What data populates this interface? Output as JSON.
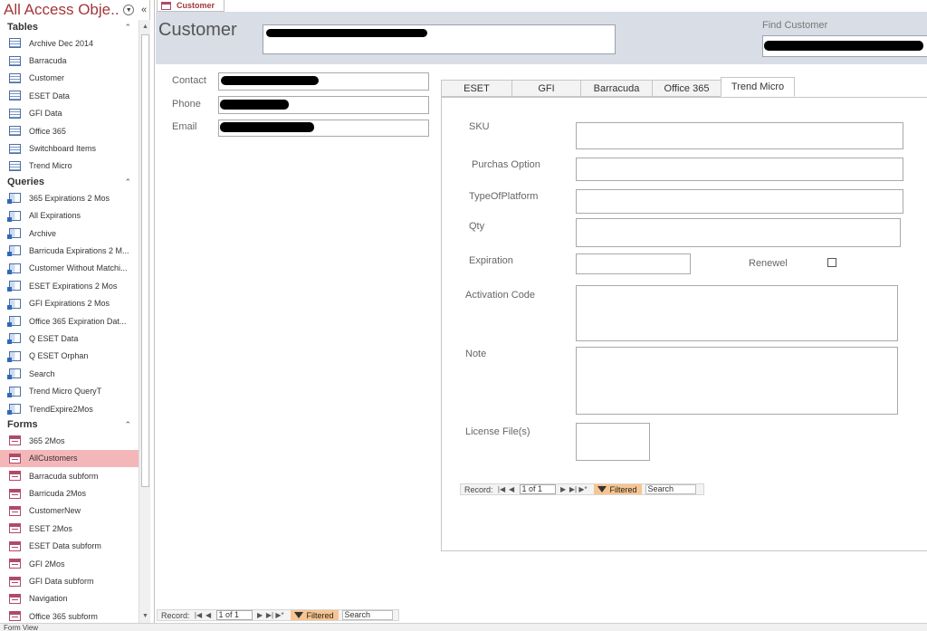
{
  "nav": {
    "title": "All Access Obje...",
    "groups": [
      {
        "label": "Tables",
        "items": [
          "Archive Dec 2014",
          "Barracuda",
          "Customer",
          "ESET Data",
          "GFI Data",
          "Office 365",
          "Switchboard Items",
          "Trend Micro"
        ]
      },
      {
        "label": "Queries",
        "items": [
          "365 Expirations 2 Mos",
          "All Expirations",
          "Archive",
          "Barricuda Expirations 2 M...",
          "Customer Without Matchi...",
          "ESET Expirations 2 Mos",
          "GFI Expirations 2 Mos",
          "Office 365 Expiration Dat...",
          "Q ESET Data",
          "Q ESET Orphan",
          "Search",
          "Trend Micro QueryT",
          "TrendExpire2Mos"
        ]
      },
      {
        "label": "Forms",
        "items": [
          "365 2Mos",
          "AllCustomers",
          "Barracuda subform",
          "Barricuda 2Mos",
          "CustomerNew",
          "ESET 2Mos",
          "ESET Data subform",
          "GFI 2Mos",
          "GFI Data subform",
          "Navigation",
          "Office 365 subform"
        ]
      }
    ],
    "selected": "AllCustomers"
  },
  "doc_tab": "Customer",
  "form": {
    "title": "Customer",
    "find_label": "Find Customer",
    "contact_label": "Contact",
    "phone_label": "Phone",
    "email_label": "Email"
  },
  "tabs": [
    "ESET",
    "GFI",
    "Barracuda",
    "Office 365",
    "Trend Micro"
  ],
  "active_tab": "Trend Micro",
  "trend": {
    "sku_label": "SKU",
    "purchase_label": "Purchas Option",
    "platform_label": "TypeOfPlatform",
    "qty_label": "Qty",
    "expiration_label": "Expiration",
    "renewal_label": "Renewel",
    "activation_label": "Activation Code",
    "note_label": "Note",
    "license_label": "License File(s)"
  },
  "subnav": {
    "label": "Record:",
    "current": "1 of 1",
    "filtered": "Filtered",
    "search": "Search"
  },
  "mainnav": {
    "label": "Record:",
    "current": "1 of 1",
    "filtered": "Filtered",
    "search": "Search"
  },
  "status": "Form View"
}
